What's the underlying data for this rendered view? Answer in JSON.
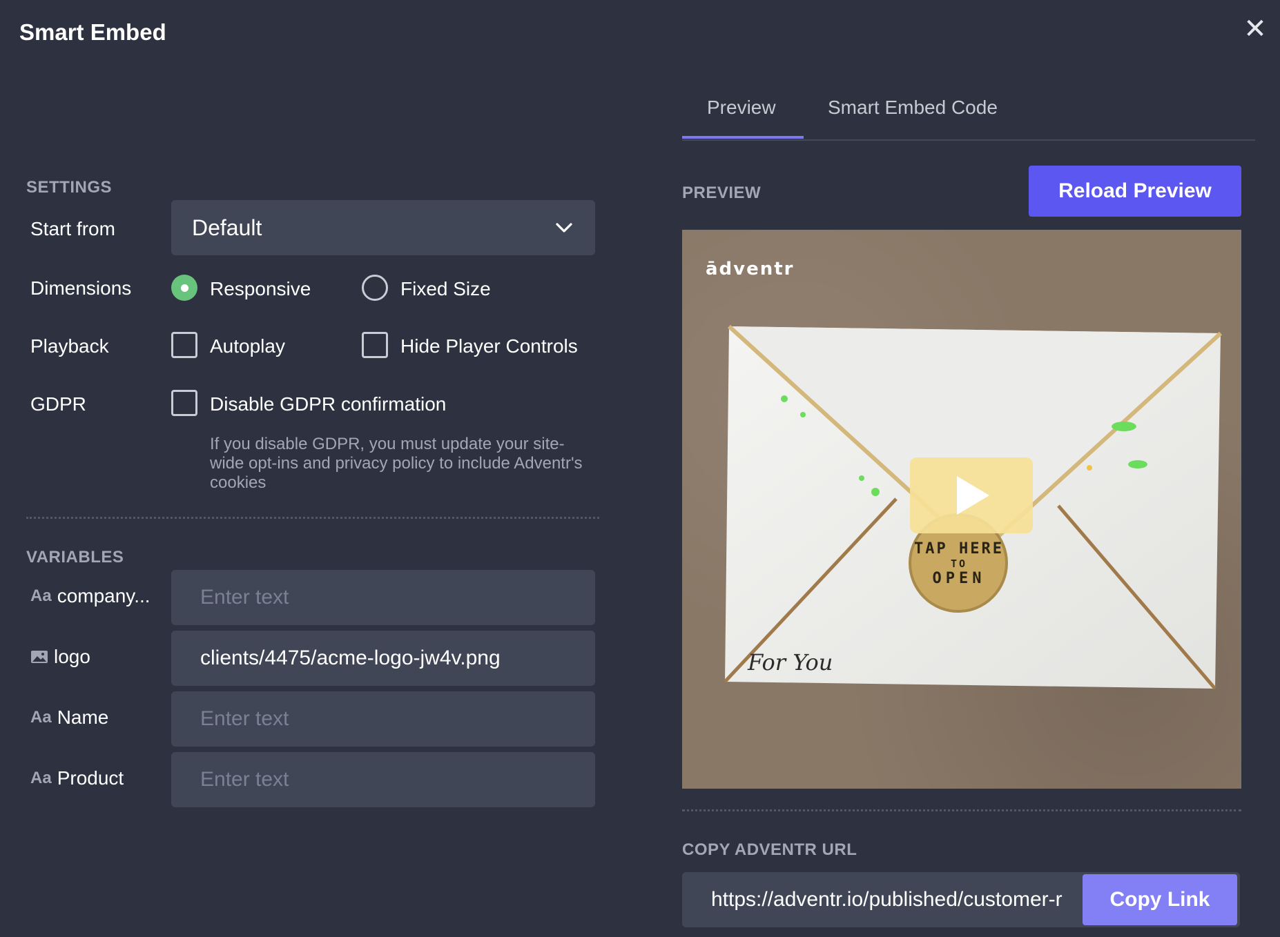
{
  "window": {
    "title": "Smart Embed",
    "close_icon": "close-icon"
  },
  "settings": {
    "section_label": "SETTINGS",
    "start_from": {
      "label": "Start from",
      "value": "Default"
    },
    "dimensions": {
      "label": "Dimensions",
      "options": [
        {
          "label": "Responsive",
          "selected": true
        },
        {
          "label": "Fixed Size",
          "selected": false
        }
      ]
    },
    "playback": {
      "label": "Playback",
      "options": [
        {
          "label": "Autoplay",
          "checked": false
        },
        {
          "label": "Hide Player Controls",
          "checked": false
        }
      ]
    },
    "gdpr": {
      "label": "GDPR",
      "option": {
        "label": "Disable GDPR confirmation",
        "checked": false
      },
      "help": "If you disable GDPR, you must update your site-wide opt-ins and privacy policy to include Adventr's cookies"
    }
  },
  "variables": {
    "section_label": "VARIABLES",
    "items": [
      {
        "type_icon": "Aa",
        "name": "company...",
        "value": "",
        "placeholder": "Enter text"
      },
      {
        "type_icon": "image-icon",
        "name": "logo",
        "value": "clients/4475/acme-logo-jw4v.png",
        "placeholder": ""
      },
      {
        "type_icon": "Aa",
        "name": "Name",
        "value": "",
        "placeholder": "Enter text"
      },
      {
        "type_icon": "Aa",
        "name": "Product",
        "value": "",
        "placeholder": "Enter text"
      }
    ]
  },
  "tabs": [
    {
      "label": "Preview",
      "active": true
    },
    {
      "label": "Smart Embed Code",
      "active": false
    }
  ],
  "preview": {
    "section_label": "PREVIEW",
    "reload_label": "Reload Preview",
    "brand": "ādventr",
    "seal_top": "TAP HERE",
    "seal_mid": "TO",
    "seal_bottom": "OPEN",
    "envelope_note": "For You"
  },
  "copy_url": {
    "section_label": "COPY ADVENTR URL",
    "url": "https://adventr.io/published/customer-r",
    "button_label": "Copy Link"
  },
  "colors": {
    "background": "#2e3240",
    "field": "#414656",
    "accent": "#5b57f0",
    "accent_light": "#837ff4",
    "radio_on": "#68c47c",
    "muted_text": "#a2a7b5"
  }
}
